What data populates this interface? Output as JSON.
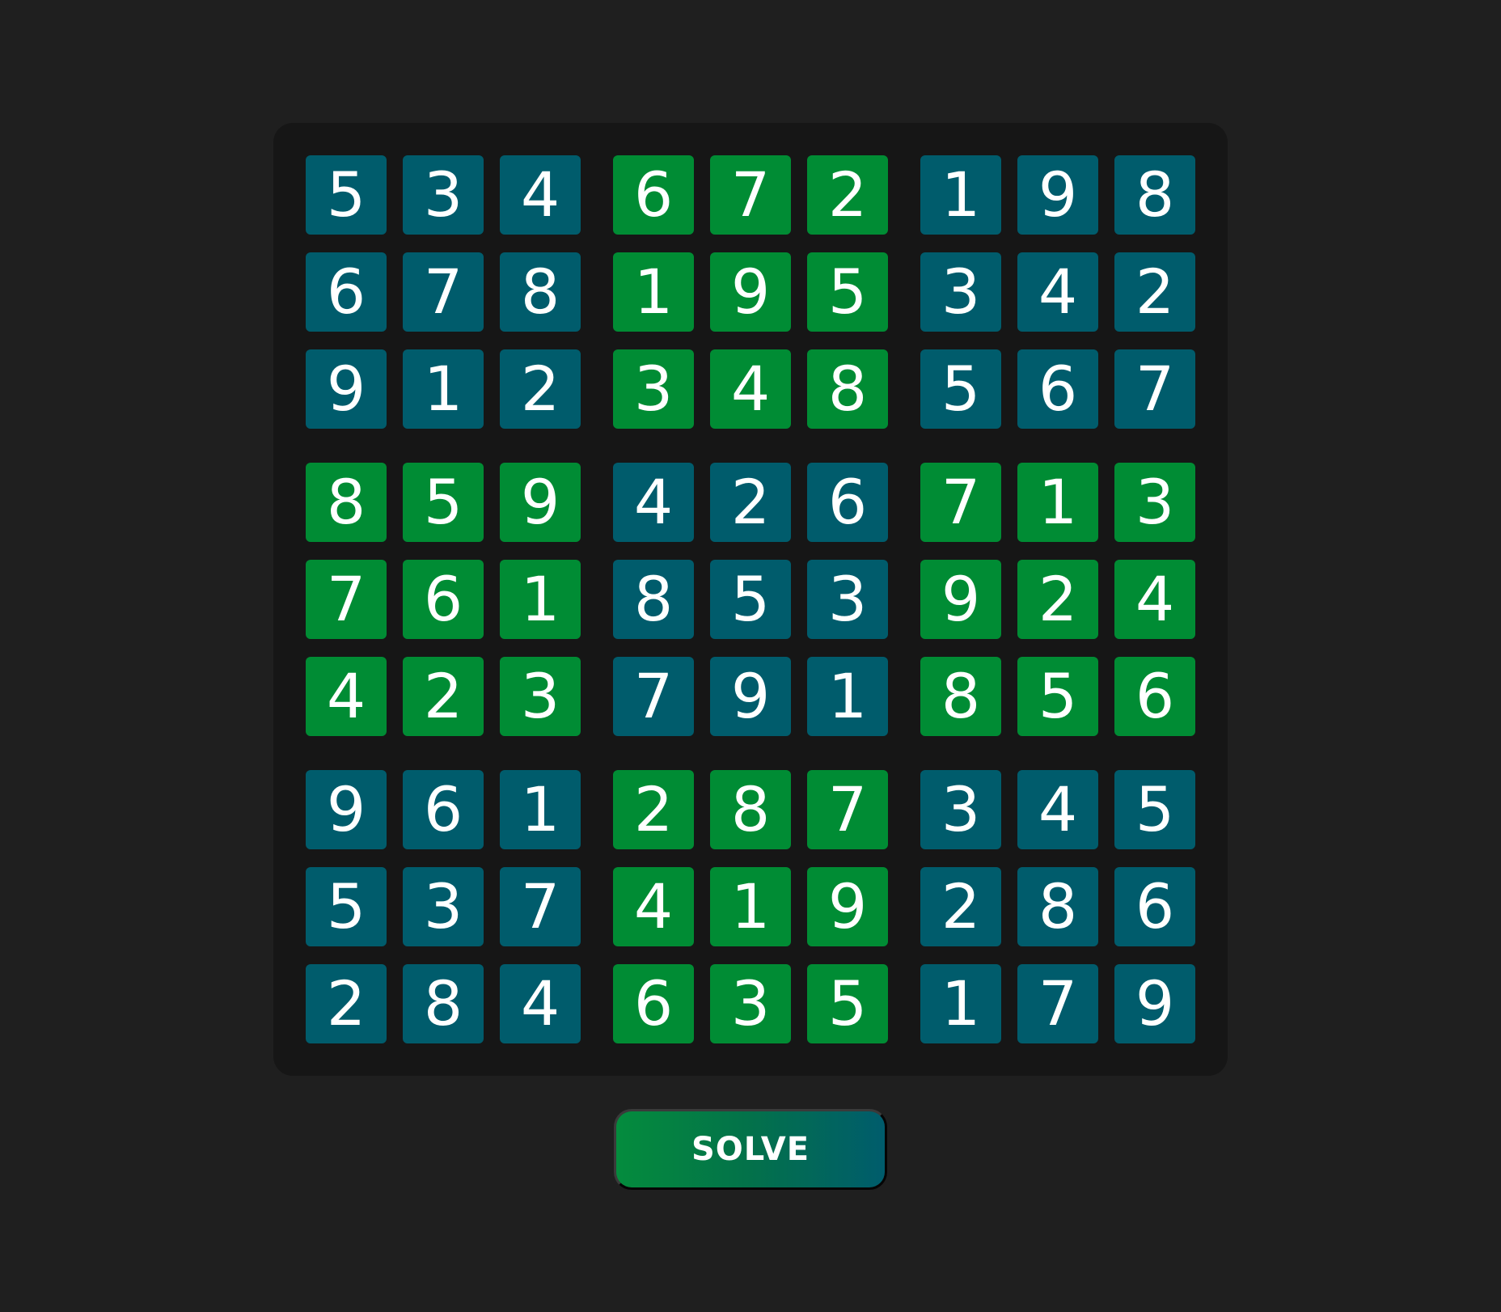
{
  "colors": {
    "background": "#1f1f1f",
    "board": "#161616",
    "teal": "#005c6c",
    "green": "#008c34",
    "text": "#ffffff"
  },
  "grid": [
    [
      5,
      3,
      4,
      6,
      7,
      2,
      1,
      9,
      8
    ],
    [
      6,
      7,
      8,
      1,
      9,
      5,
      3,
      4,
      2
    ],
    [
      9,
      1,
      2,
      3,
      4,
      8,
      5,
      6,
      7
    ],
    [
      8,
      5,
      9,
      4,
      2,
      6,
      7,
      1,
      3
    ],
    [
      7,
      6,
      1,
      8,
      5,
      3,
      9,
      2,
      4
    ],
    [
      4,
      2,
      3,
      7,
      9,
      1,
      8,
      5,
      6
    ],
    [
      9,
      6,
      1,
      2,
      8,
      7,
      3,
      4,
      5
    ],
    [
      5,
      3,
      7,
      4,
      1,
      9,
      2,
      8,
      6
    ],
    [
      2,
      8,
      4,
      6,
      3,
      5,
      1,
      7,
      9
    ]
  ],
  "box_colors": [
    [
      "teal",
      "green",
      "teal"
    ],
    [
      "green",
      "teal",
      "green"
    ],
    [
      "teal",
      "green",
      "teal"
    ]
  ],
  "solve_button": {
    "label": "SOLVE"
  }
}
